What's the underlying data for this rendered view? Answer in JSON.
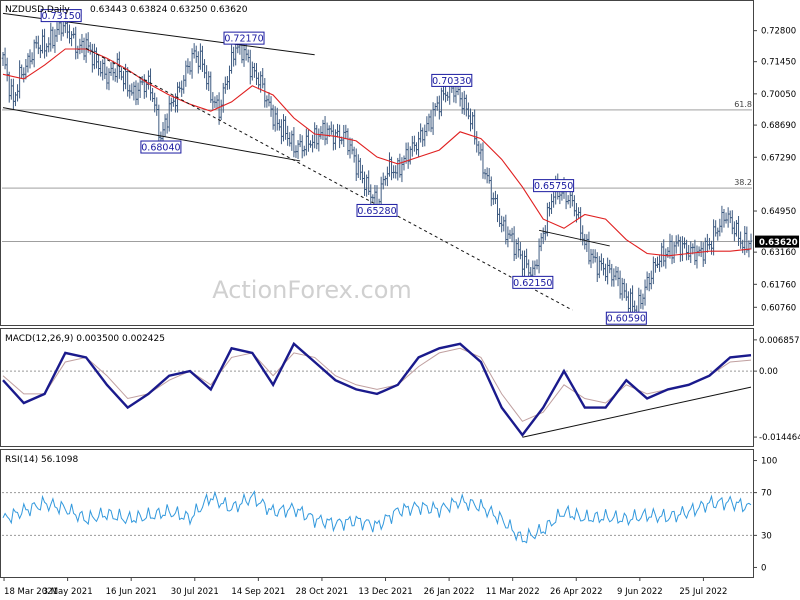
{
  "header": {
    "symbol": "NZDUSD,Daily",
    "ohlc": "0.63443 0.63824 0.63250 0.63620"
  },
  "watermark": "ActionForex.com",
  "colors": {
    "price_bar": "#3d5a80",
    "ma_line": "#e02020",
    "macd_line": "#1a1a8c",
    "signal_line": "#c0a0a0",
    "rsi_line": "#3399dd",
    "label_border": "#1a1aa0",
    "last_price_bg": "#000000"
  },
  "chart_data": [
    {
      "type": "line",
      "pane": "price",
      "title": "NZDUSD,Daily",
      "y_ticks": [
        0.6076,
        0.6176,
        0.6316,
        0.6495,
        0.6729,
        0.6869,
        0.7005,
        0.7145,
        0.728
      ],
      "y_tick_labels": [
        "0.60760",
        "0.61760",
        "0.63160",
        "0.64950",
        "0.67290",
        "0.68690",
        "0.70050",
        "0.71450",
        "0.72800"
      ],
      "ylim": [
        0.6012,
        0.7396
      ],
      "x_tick_labels": [
        "18 Mar 2021",
        "3 May 2021",
        "16 Jun 2021",
        "30 Jul 2021",
        "14 Sep 2021",
        "28 Oct 2021",
        "13 Dec 2021",
        "26 Jan 2022",
        "11 Mar 2022",
        "26 Apr 2022",
        "9 Jun 2022",
        "25 Jul 2022"
      ],
      "close_series": {
        "x": [
          0,
          3,
          5,
          8,
          12,
          16,
          20,
          25,
          28,
          32,
          36,
          40,
          45,
          50,
          55,
          60,
          63,
          66,
          70,
          72,
          76,
          80,
          85,
          88,
          92,
          96,
          100,
          104,
          108,
          112,
          116,
          120,
          124,
          128,
          132,
          136,
          140,
          145,
          150,
          155,
          160,
          165,
          170,
          175,
          180,
          185,
          190,
          195,
          200,
          205,
          208,
          212,
          216,
          220,
          225,
          230,
          235,
          240,
          245,
          250,
          255,
          260,
          265,
          270,
          275,
          280,
          285,
          290,
          295,
          300,
          305,
          310,
          315,
          320,
          325,
          330,
          335,
          340,
          345,
          348,
          352,
          356,
          360
        ],
        "values": [
          0.716,
          0.704,
          0.697,
          0.708,
          0.714,
          0.722,
          0.721,
          0.726,
          0.7306,
          0.727,
          0.72,
          0.722,
          0.714,
          0.708,
          0.712,
          0.704,
          0.7,
          0.704,
          0.705,
          0.7,
          0.6806,
          0.694,
          0.702,
          0.71,
          0.718,
          0.714,
          0.7,
          0.693,
          0.708,
          0.7213,
          0.719,
          0.71,
          0.706,
          0.695,
          0.687,
          0.684,
          0.677,
          0.678,
          0.681,
          0.685,
          0.682,
          0.682,
          0.67,
          0.66,
          0.6531,
          0.668,
          0.667,
          0.675,
          0.68,
          0.688,
          0.694,
          0.7,
          0.7031,
          0.699,
          0.69,
          0.672,
          0.658,
          0.643,
          0.637,
          0.628,
          0.6218,
          0.64,
          0.658,
          0.6574,
          0.652,
          0.635,
          0.627,
          0.624,
          0.621,
          0.612,
          0.6062,
          0.618,
          0.628,
          0.632,
          0.635,
          0.632,
          0.631,
          0.635,
          0.644,
          0.648,
          0.642,
          0.635,
          0.6362
        ]
      },
      "ma_series": {
        "x": [
          0,
          10,
          20,
          30,
          40,
          50,
          60,
          70,
          80,
          90,
          100,
          110,
          120,
          130,
          140,
          150,
          160,
          170,
          180,
          190,
          200,
          210,
          220,
          230,
          240,
          250,
          260,
          270,
          280,
          290,
          300,
          310,
          320,
          330,
          340,
          350,
          360
        ],
        "values": [
          0.709,
          0.707,
          0.713,
          0.72,
          0.72,
          0.716,
          0.711,
          0.705,
          0.7,
          0.696,
          0.693,
          0.697,
          0.704,
          0.7,
          0.69,
          0.683,
          0.682,
          0.68,
          0.673,
          0.67,
          0.673,
          0.676,
          0.684,
          0.681,
          0.672,
          0.66,
          0.646,
          0.642,
          0.648,
          0.646,
          0.637,
          0.631,
          0.63,
          0.631,
          0.632,
          0.632,
          0.633
        ]
      },
      "level_labels": [
        {
          "x": 28,
          "value": 0.7315,
          "label": "0.73150"
        },
        {
          "x": 116,
          "value": 0.7217,
          "label": "0.72170"
        },
        {
          "x": 76,
          "value": 0.6804,
          "label": "0.68040"
        },
        {
          "x": 180,
          "value": 0.6528,
          "label": "0.65280"
        },
        {
          "x": 216,
          "value": 0.7033,
          "label": "0.70330"
        },
        {
          "x": 265,
          "value": 0.6575,
          "label": "0.65750"
        },
        {
          "x": 255,
          "value": 0.6215,
          "label": "0.62150"
        },
        {
          "x": 300,
          "value": 0.6059,
          "label": "0.60590"
        }
      ],
      "horizontal_lines": [
        {
          "value": 0.6935,
          "label": "61.8"
        },
        {
          "value": 0.6595,
          "label": "38.2"
        },
        {
          "value": 0.6362,
          "label": ""
        }
      ],
      "trend_lines": [
        {
          "from": [
            0,
            0.7355
          ],
          "to": [
            150,
            0.7175
          ],
          "style": "solid"
        },
        {
          "from": [
            0,
            0.6945
          ],
          "to": [
            143,
            0.6713
          ],
          "style": "solid"
        },
        {
          "from": [
            40,
            0.7203
          ],
          "to": [
            274,
            0.6064
          ],
          "style": "dashed"
        },
        {
          "from": [
            258,
            0.6411
          ],
          "to": [
            292,
            0.6343
          ],
          "style": "solid"
        }
      ],
      "last_price": {
        "value": 0.6362,
        "label": "0.63620"
      }
    },
    {
      "type": "line",
      "pane": "macd",
      "title": "MACD(12,26,9) 0.003500 0.002425",
      "y_tick_labels": [
        "0.006857",
        "0.00",
        "-0.014464"
      ],
      "y_ticks": [
        0.006857,
        0.0,
        -0.014464
      ],
      "ylim": [
        -0.0162,
        0.0088
      ],
      "series": [
        {
          "x": [
            0,
            10,
            20,
            30,
            40,
            50,
            60,
            70,
            80,
            90,
            100,
            110,
            120,
            130,
            140,
            150,
            160,
            170,
            180,
            190,
            200,
            210,
            220,
            230,
            240,
            250,
            260,
            270,
            280,
            290,
            300,
            310,
            320,
            330,
            340,
            350,
            360
          ],
          "values": [
            -0.002,
            -0.007,
            -0.005,
            0.004,
            0.003,
            -0.003,
            -0.008,
            -0.005,
            -0.001,
            0.0,
            -0.004,
            0.005,
            0.004,
            -0.003,
            0.006,
            0.002,
            -0.002,
            -0.004,
            -0.005,
            -0.003,
            0.003,
            0.005,
            0.006,
            0.002,
            -0.008,
            -0.014,
            -0.008,
            0.0,
            -0.008,
            -0.008,
            -0.002,
            -0.006,
            -0.004,
            -0.003,
            -0.001,
            0.003,
            0.0035
          ]
        },
        {
          "x": [
            0,
            10,
            20,
            30,
            40,
            50,
            60,
            70,
            80,
            90,
            100,
            110,
            120,
            130,
            140,
            150,
            160,
            170,
            180,
            190,
            200,
            210,
            220,
            230,
            240,
            250,
            260,
            270,
            280,
            290,
            300,
            310,
            320,
            330,
            340,
            350,
            360
          ],
          "values": [
            -0.001,
            -0.005,
            -0.005,
            0.002,
            0.003,
            -0.001,
            -0.006,
            -0.005,
            -0.002,
            0.0,
            -0.003,
            0.003,
            0.004,
            -0.001,
            0.004,
            0.003,
            -0.001,
            -0.003,
            -0.004,
            -0.003,
            0.001,
            0.004,
            0.005,
            0.003,
            -0.005,
            -0.011,
            -0.009,
            -0.003,
            -0.006,
            -0.007,
            -0.003,
            -0.005,
            -0.004,
            -0.003,
            -0.001,
            0.002,
            0.002425
          ]
        }
      ],
      "trend_line": {
        "from": [
          250,
          -0.0145
        ],
        "to": [
          360,
          -0.0035
        ]
      }
    },
    {
      "type": "line",
      "pane": "rsi",
      "title": "RSI(14) 56.1098",
      "y_ticks": [
        0,
        30,
        70,
        100
      ],
      "y_tick_labels": [
        "0",
        "30",
        "70",
        "100"
      ],
      "ylim": [
        -8,
        108
      ],
      "levels": [
        30,
        70
      ],
      "series": [
        {
          "x": [
            0,
            10,
            20,
            30,
            40,
            50,
            60,
            70,
            80,
            90,
            100,
            110,
            120,
            130,
            140,
            150,
            160,
            170,
            180,
            190,
            200,
            210,
            220,
            230,
            240,
            250,
            260,
            270,
            280,
            290,
            300,
            310,
            320,
            330,
            340,
            350,
            360
          ],
          "values": [
            45,
            53,
            60,
            55,
            45,
            50,
            45,
            48,
            52,
            46,
            66,
            55,
            66,
            52,
            55,
            45,
            41,
            44,
            39,
            53,
            57,
            54,
            62,
            57,
            45,
            26,
            35,
            52,
            46,
            47,
            45,
            49,
            47,
            52,
            60,
            61,
            56
          ]
        }
      ]
    }
  ]
}
